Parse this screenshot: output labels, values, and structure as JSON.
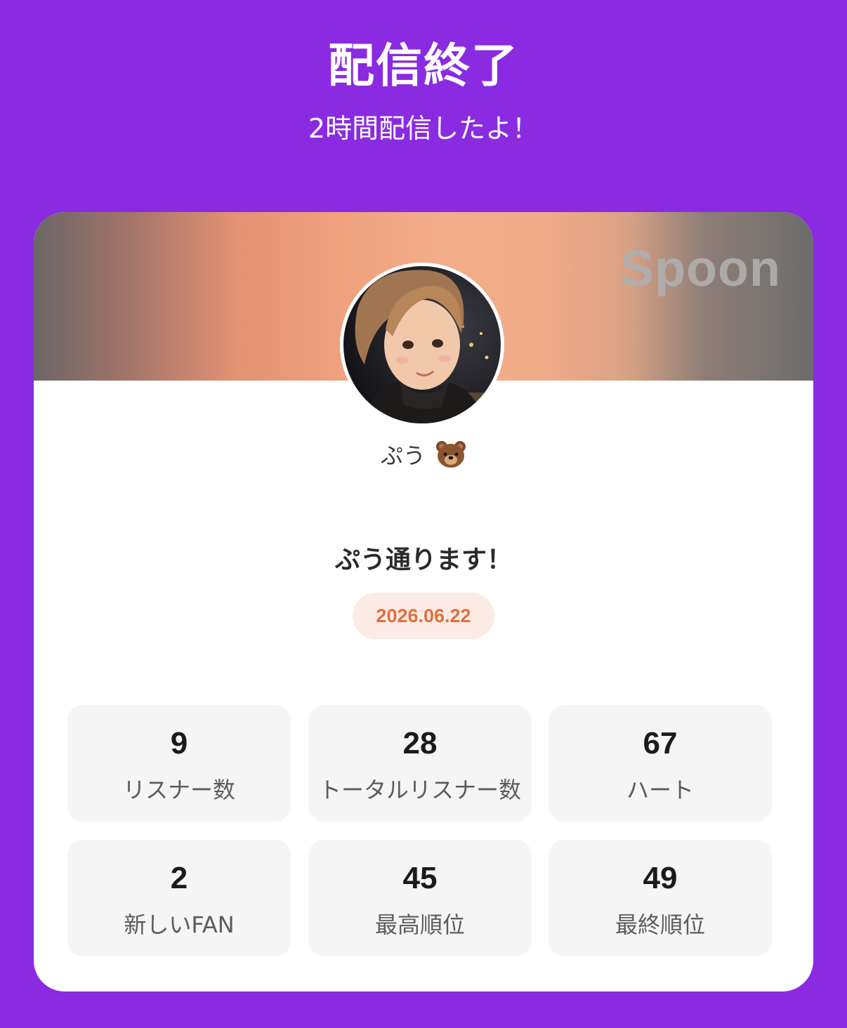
{
  "header": {
    "title": "配信終了",
    "subtitle": "2時間配信したよ！"
  },
  "card": {
    "brand": "Spoon",
    "username": "ぷう",
    "username_icon": "bear-face-icon",
    "stream_title": "ぷう通ります！",
    "date": "2026.06.22",
    "colors": {
      "accent": "#e0703e",
      "background": "#8a2be2"
    },
    "stats": [
      {
        "value": "9",
        "label": "リスナー数"
      },
      {
        "value": "28",
        "label": "トータルリスナー数"
      },
      {
        "value": "67",
        "label": "ハート"
      },
      {
        "value": "2",
        "label": "新しいFAN"
      },
      {
        "value": "45",
        "label": "最高順位"
      },
      {
        "value": "49",
        "label": "最終順位"
      }
    ]
  }
}
